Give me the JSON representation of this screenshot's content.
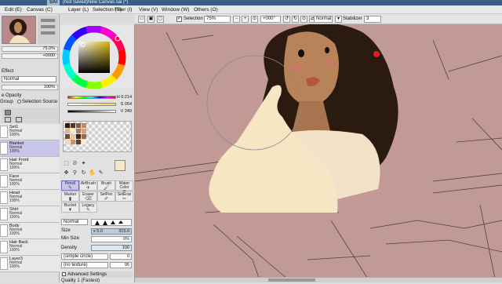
{
  "window": {
    "app_logo": "SAI",
    "title": "(Not Saved)New Canvas.sai (*)"
  },
  "menu": [
    "Edit (E)",
    "Canvas (C)",
    "Layer (L)",
    "Selection (S)",
    "Filter (I)",
    "View (V)",
    "Window (W)",
    "Others (O)"
  ],
  "toolbar": {
    "selection_label": "Selection",
    "selection_checked": true,
    "zoom": "75%",
    "rotation": "+000°",
    "blend_mode": "Normal",
    "stabilizer_label": "Stabilizer",
    "stabilizer_value": "3"
  },
  "navigator": {
    "zoom": "75.0%",
    "angle": "+0000"
  },
  "layer_panel": {
    "effect_label": "Effect",
    "mode": "Normal",
    "opacity_value": "100%",
    "preserve_opacity": "e Opacity",
    "clipping_group": "Group",
    "selection_source": "Selection Source"
  },
  "layers": [
    {
      "name": "Set1",
      "mode": "Normal",
      "opacity": "100%",
      "selected": false
    },
    {
      "name": "Blanket",
      "mode": "Normal",
      "opacity": "100%",
      "selected": true
    },
    {
      "name": "Hair Front",
      "mode": "Normal",
      "opacity": "100%",
      "selected": false
    },
    {
      "name": "Face",
      "mode": "Normal",
      "opacity": "100%",
      "selected": false
    },
    {
      "name": "Head",
      "mode": "Normal",
      "opacity": "100%",
      "selected": false
    },
    {
      "name": "Shirt",
      "mode": "Normal",
      "opacity": "100%",
      "selected": false
    },
    {
      "name": "Body",
      "mode": "Normal",
      "opacity": "100%",
      "selected": false
    },
    {
      "name": "Hair Back",
      "mode": "Normal",
      "opacity": "100%",
      "selected": false
    },
    {
      "name": "Layer3",
      "mode": "Normal",
      "opacity": "100%",
      "selected": false
    }
  ],
  "color": {
    "h": "H 0:214",
    "s": "S 054",
    "v": "V 249",
    "current_hex": "#f6e7c8",
    "swatches": [
      "#2b1a10",
      "#5a3320",
      "#8b5a3c",
      "#c08a5e",
      "#e0b890",
      "#f6e7c8",
      "#b07a60",
      "#d8a07a",
      "#7a4a30",
      "#e8c8a0",
      "#3a2416",
      "#a06848",
      "#f0d8b8",
      "#c89470",
      "#6a3e26",
      "#f8eed8"
    ]
  },
  "brushes": [
    {
      "name": "Pencil",
      "selected": true
    },
    {
      "name": "AirBrush",
      "selected": false
    },
    {
      "name": "Brush",
      "selected": false
    },
    {
      "name": "Water Color",
      "selected": false
    },
    {
      "name": "Marker",
      "selected": false
    },
    {
      "name": "Eraser",
      "selected": false
    },
    {
      "name": "SelPen",
      "selected": false
    },
    {
      "name": "SelEras",
      "selected": false
    },
    {
      "name": "Bucket",
      "selected": false
    },
    {
      "name": "Legacy",
      "selected": false
    }
  ],
  "brush_settings": {
    "mode": "Normal",
    "size_label": "Size",
    "size_multiplier": "x 5.0",
    "size_value": "315.0",
    "min_size_label": "Min Size",
    "min_size_value": "0%",
    "density_label": "Density",
    "density_value": "100",
    "shape1": "(simple circle)",
    "shape1_value": "0",
    "shape2": "(no texture)",
    "shape2_value": "95",
    "advanced": "Advanced Settings",
    "quality": "Quality    1 (Fastest)"
  }
}
